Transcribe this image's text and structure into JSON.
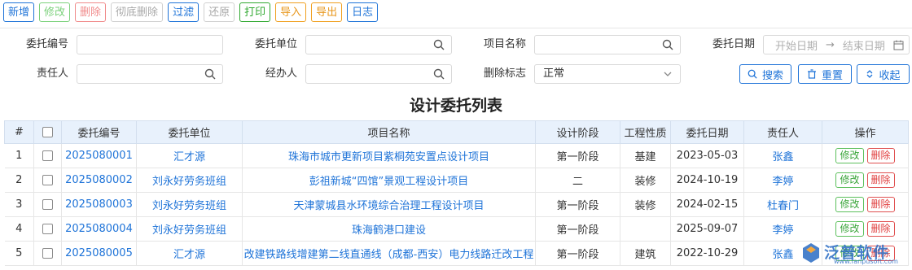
{
  "toolbar": {
    "buttons": [
      {
        "label": "新增",
        "style": "blue"
      },
      {
        "label": "修改",
        "style": "green"
      },
      {
        "label": "删除",
        "style": "red"
      },
      {
        "label": "彻底删除",
        "style": "gray"
      },
      {
        "label": "过滤",
        "style": "blue"
      },
      {
        "label": "还原",
        "style": "gray"
      },
      {
        "label": "打印",
        "style": "dgreen"
      },
      {
        "label": "导入",
        "style": "orange"
      },
      {
        "label": "导出",
        "style": "orange"
      },
      {
        "label": "日志",
        "style": "blue"
      }
    ]
  },
  "filters": {
    "contract_no_label": "委托编号",
    "contract_no_value": "",
    "unit_label": "委托单位",
    "unit_value": "",
    "project_label": "项目名称",
    "project_value": "",
    "date_label": "委托日期",
    "date_start_placeholder": "开始日期",
    "date_arrow": "→",
    "date_end_placeholder": "结束日期",
    "owner_label": "责任人",
    "owner_value": "",
    "handler_label": "经办人",
    "handler_value": "",
    "delete_flag_label": "删除标志",
    "delete_flag_value": "正常"
  },
  "actions": {
    "search": "搜索",
    "reset": "重置",
    "collapse": "收起"
  },
  "list_title": "设计委托列表",
  "table": {
    "headers": [
      "#",
      "",
      "委托编号",
      "委托单位",
      "项目名称",
      "设计阶段",
      "工程性质",
      "委托日期",
      "责任人",
      "操作"
    ],
    "edit_label": "修改",
    "delete_label": "删除",
    "rows": [
      {
        "idx": "1",
        "no": "2025080001",
        "unit": "汇才源",
        "project": "珠海市城市更新项目紫桐苑安置点设计项目",
        "phase": "第一阶段",
        "nature": "基建",
        "date": "2023-05-03",
        "owner": "张鑫"
      },
      {
        "idx": "2",
        "no": "2025080002",
        "unit": "刘永好劳务班组",
        "project": "彭祖新城“四馆”景观工程设计项目",
        "phase": "二",
        "nature": "装修",
        "date": "2024-10-19",
        "owner": "李婷"
      },
      {
        "idx": "3",
        "no": "2025080003",
        "unit": "刘永好劳务班组",
        "project": "天津蒙城县水环境综合治理工程设计项目",
        "phase": "第一阶段",
        "nature": "装修",
        "date": "2024-02-15",
        "owner": "杜春门"
      },
      {
        "idx": "4",
        "no": "2025080004",
        "unit": "刘永好劳务班组",
        "project": "珠海鹤港口建设",
        "phase": "第一阶段",
        "nature": "",
        "date": "2025-09-07",
        "owner": "李婷"
      },
      {
        "idx": "5",
        "no": "2025080005",
        "unit": "汇才源",
        "project": "改建铁路线增建第二线直通线（成都-西安）电力线路迁改工程",
        "phase": "第一阶段",
        "nature": "建筑",
        "date": "2022-10-29",
        "owner": "张鑫"
      }
    ]
  },
  "logo": {
    "text": "泛普软件",
    "sub": "www.fanpusoft.com"
  }
}
